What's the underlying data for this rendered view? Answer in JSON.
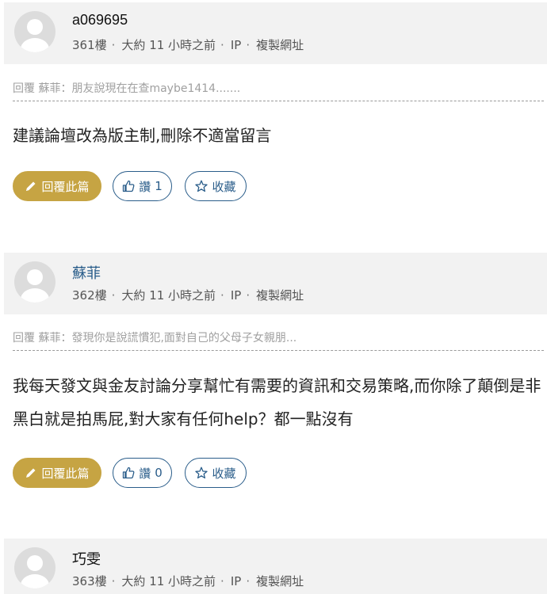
{
  "posts": [
    {
      "username": "a069695",
      "floor": "361樓",
      "time": "大約 11 小時之前",
      "ip": "IP",
      "copy_link": "複製網址",
      "quote": "回覆 蘇菲：朋友說現在在查maybe1414.......",
      "body": "建議論壇改為版主制,刪除不適當留言",
      "reply_label": "回覆此篇",
      "like_label": "讚",
      "like_count": "1",
      "fav_label": "收藏"
    },
    {
      "username": "蘇菲",
      "floor": "362樓",
      "time": "大約 11 小時之前",
      "ip": "IP",
      "copy_link": "複製網址",
      "quote": "回覆 蘇菲：發現你是說謊慣犯,面對自己的父母子女親朋...",
      "body": "我每天發文與金友討論分享幫忙有需要的資訊和交易策略,而你除了顛倒是非黑白就是拍馬屁,對大家有任何help？都一點沒有",
      "reply_label": "回覆此篇",
      "like_label": "讚",
      "like_count": "0",
      "fav_label": "收藏"
    },
    {
      "username": "巧雯",
      "floor": "363樓",
      "time": "大約 11 小時之前",
      "ip": "IP",
      "copy_link": "複製網址"
    }
  ],
  "colors": {
    "accent_gold": "#c6a443",
    "accent_blue": "#2a5d8a",
    "header_bg": "#f2f2f2"
  },
  "icons": [
    "avatar-placeholder",
    "pencil-icon",
    "thumbs-up-icon",
    "star-icon"
  ]
}
